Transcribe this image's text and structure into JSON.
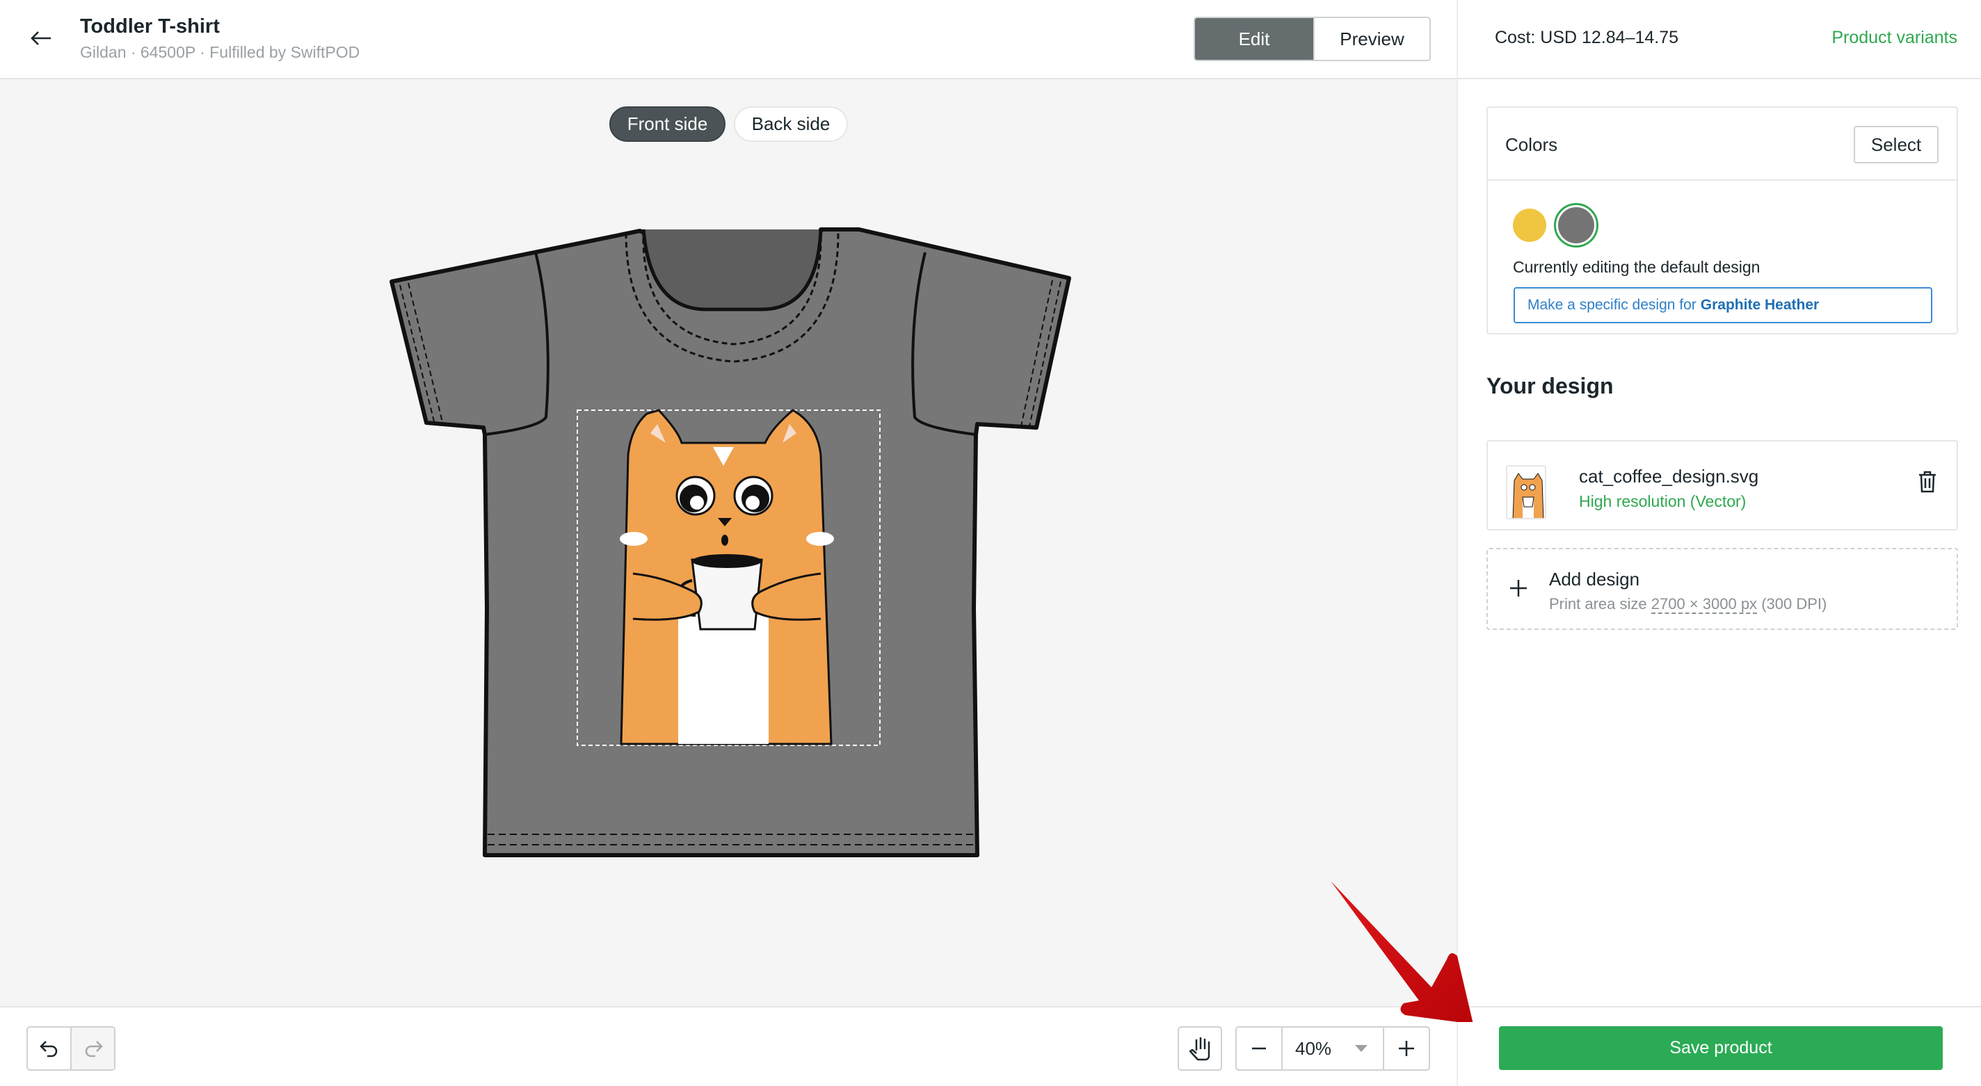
{
  "header": {
    "back_icon": "arrow-left-icon",
    "title": "Toddler T-shirt",
    "subtitle": "Gildan · 64500P · Fulfilled by SwiftPOD",
    "mode_tabs": [
      {
        "label": "Edit",
        "active": true
      },
      {
        "label": "Preview",
        "active": false
      }
    ]
  },
  "canvas": {
    "sides": [
      {
        "label": "Front side",
        "active": true
      },
      {
        "label": "Back side",
        "active": false
      }
    ],
    "product_color": "#747474",
    "design_name": "cat_coffee_design"
  },
  "bottom_toolbar": {
    "undo_icon": "undo-icon",
    "redo_icon": "redo-icon",
    "redo_disabled": true,
    "pan_icon": "hand-icon",
    "zoom_out_icon": "minus-icon",
    "zoom_in_icon": "plus-icon",
    "zoom_value": "40%"
  },
  "sidebar": {
    "cost": "Cost: USD 12.84–14.75",
    "variants_link": "Product variants",
    "colors": {
      "title": "Colors",
      "select_label": "Select",
      "swatches": [
        {
          "name": "Yellow",
          "hex": "#f0c540",
          "selected": false
        },
        {
          "name": "Graphite Heather",
          "hex": "#747474",
          "selected": true
        }
      ],
      "editing_text": "Currently editing the default design",
      "specific_prefix": "Make a specific design for",
      "specific_color": "Graphite Heather"
    },
    "your_design": {
      "title": "Your design",
      "file_name": "cat_coffee_design.svg",
      "file_resolution": "High resolution (Vector)",
      "delete_icon": "trash-icon"
    },
    "add_design": {
      "title": "Add design",
      "sub_prefix": "Print area size",
      "sub_dims": "2700 × 3000 px",
      "sub_suffix": "(300 DPI)"
    },
    "save_label": "Save product"
  },
  "colors": {
    "accent_green": "#2bab55",
    "link_blue": "#2f80c8",
    "annotation_red": "#d8151a"
  }
}
